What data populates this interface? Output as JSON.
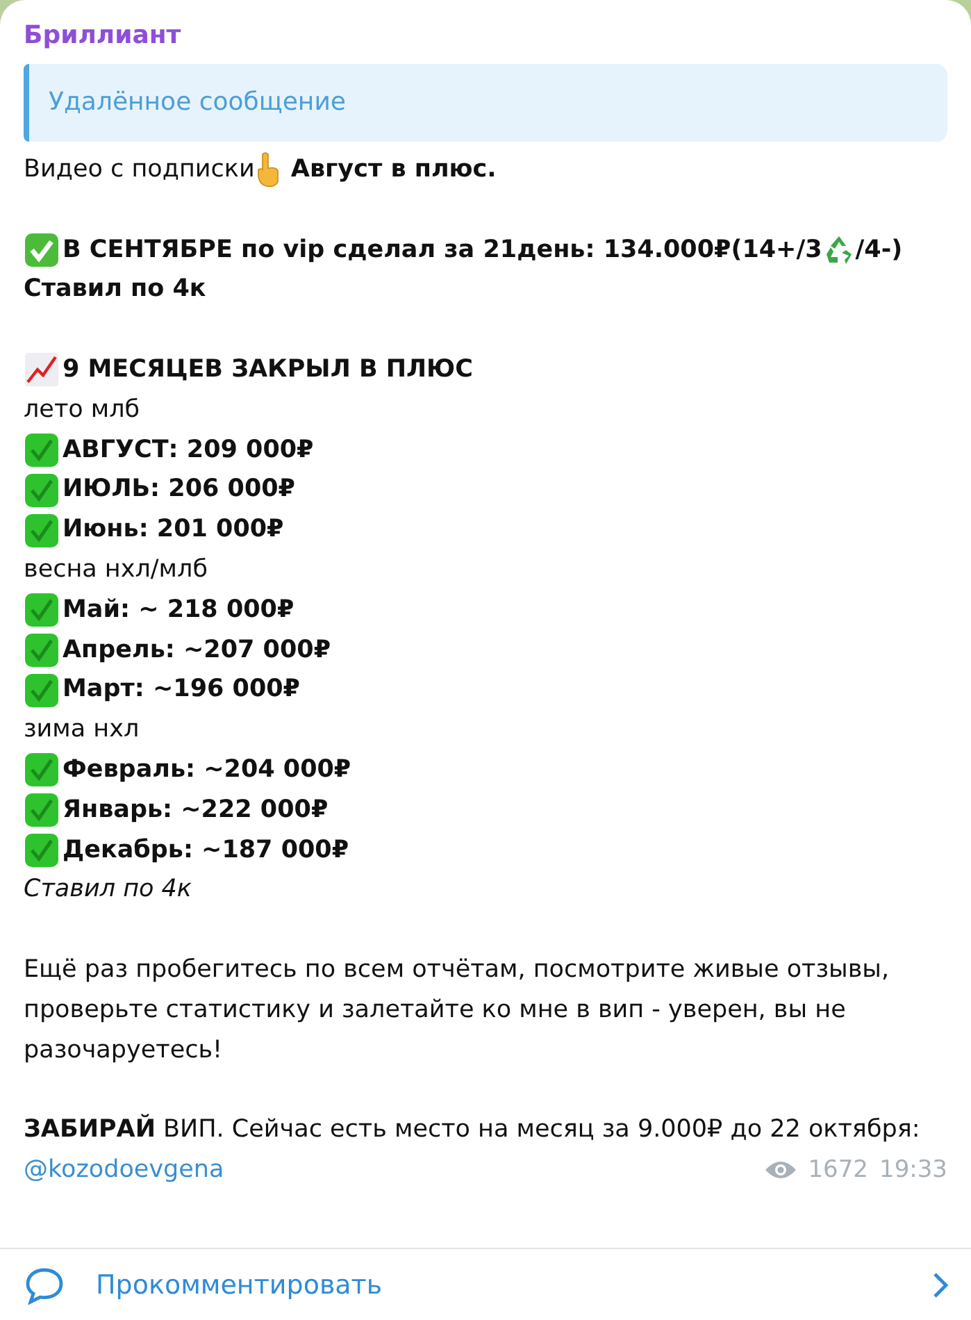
{
  "author": "Бриллиант",
  "reply_quote": "Удалённое сообщение",
  "intro": {
    "text": "Видео с подписки",
    "bold_text": "Август в плюс."
  },
  "september": {
    "text": "В СЕНТЯБРЕ по vip сделал за 21день: 134.000₽(14+/3",
    "after": "/4-)",
    "note": "Ставил по 4к"
  },
  "summary_heading": "9 МЕСЯЦЕВ ЗАКРЫЛ В ПЛЮС",
  "seasons": [
    {
      "label": "лето млб",
      "months": [
        "АВГУСТ: 209 000₽",
        "ИЮЛЬ: 206 000₽",
        "Июнь: 201 000₽"
      ]
    },
    {
      "label": "весна нхл/млб",
      "months": [
        "Май: ~ 218 000₽",
        "Апрель: ~207 000₽",
        "Март: ~196 000₽"
      ]
    },
    {
      "label": "зима нхл",
      "months": [
        "Февраль: ~204 000₽",
        "Январь: ~222 000₽",
        "Декабрь: ~187 000₽"
      ]
    }
  ],
  "stake_note": "Ставил по 4к",
  "paragraph": "Ещё раз пробегитесь по всем отчётам, посмотрите живые отзывы, проверьте статистику и залетайте ко мне в вип - уверен, вы не разочаруетесь!",
  "offer": "**ЗАБИРАЙ** ВИП. Сейчас есть место на месяц за 9.000₽ до 22 октября:",
  "link": "@kozodoevgena",
  "views": "1672",
  "time": "19:33",
  "comment_button": "Прокомментировать"
}
